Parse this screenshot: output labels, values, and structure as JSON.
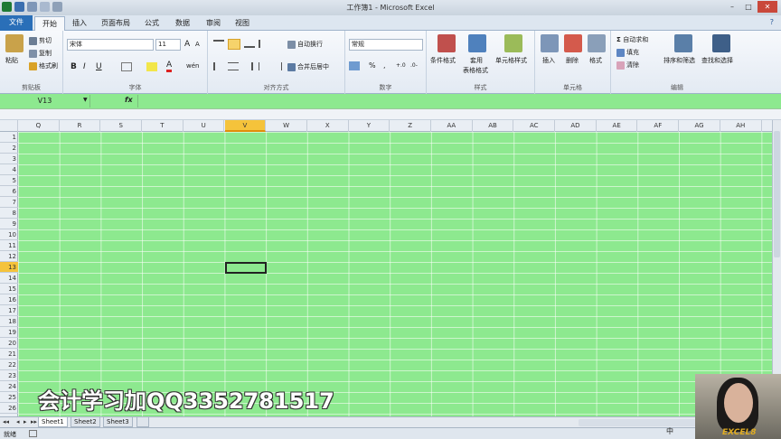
{
  "window": {
    "title": "工作簿1 - Microsoft Excel",
    "controls": [
      "–",
      "□",
      "✕"
    ]
  },
  "tabs": [
    {
      "label": "文件"
    },
    {
      "label": "开始"
    },
    {
      "label": "插入"
    },
    {
      "label": "页面布局"
    },
    {
      "label": "公式"
    },
    {
      "label": "数据"
    },
    {
      "label": "审阅"
    },
    {
      "label": "视图"
    }
  ],
  "ribbon": {
    "clipboard": {
      "group": "剪贴板",
      "paste": "粘贴",
      "cut": "剪切",
      "copy": "复制",
      "format_painter": "格式刷"
    },
    "font": {
      "group": "字体",
      "name": "宋体",
      "size": "11",
      "bold": "B",
      "italic": "I",
      "underline": "U",
      "font_color": "A",
      "grow": "A",
      "shrink": "A",
      "pinyin": "wén"
    },
    "alignment": {
      "group": "对齐方式",
      "wrap": "自动换行",
      "merge": "合并后居中"
    },
    "number": {
      "group": "数字",
      "format": "常规",
      "percent": "%",
      "comma": ",",
      "inc": "+.0",
      "dec": ".0-"
    },
    "styles": {
      "group": "样式",
      "conditional": "条件格式",
      "table_l1": "套用",
      "table_l2": "表格格式",
      "cell_styles": "单元格样式"
    },
    "cells": {
      "group": "单元格",
      "insert": "插入",
      "delete": "删除",
      "format": "格式"
    },
    "editing": {
      "group": "编辑",
      "autosum": "自动求和",
      "fill": "填充",
      "clear": "清除",
      "sort": "排序和筛选",
      "find": "查找和选择"
    }
  },
  "formula": {
    "name_box": "V13",
    "fx": "fx",
    "value": ""
  },
  "columns": [
    "Q",
    "R",
    "S",
    "T",
    "U",
    "V",
    "W",
    "X",
    "Y",
    "Z",
    "AA",
    "AB",
    "AC",
    "AD",
    "AE",
    "AF",
    "AG",
    "AH"
  ],
  "rows": [
    "1",
    "2",
    "3",
    "4",
    "5",
    "6",
    "7",
    "8",
    "9",
    "10",
    "11",
    "12",
    "13",
    "14",
    "15",
    "16",
    "17",
    "18",
    "19",
    "20",
    "21",
    "22",
    "23",
    "24",
    "25",
    "26"
  ],
  "selected": {
    "column": "V",
    "row": "13"
  },
  "sheets": [
    "Sheet1",
    "Sheet2",
    "Sheet3"
  ],
  "status": {
    "text": "就绪",
    "ime": "中"
  },
  "overlay": {
    "watermark": "会计学习加QQ3352781517",
    "logo": "EXCEL8"
  },
  "colors": {
    "sheet_bg": "#8de98f",
    "selected_header": "#f5c33b",
    "file_tab": "#2a6fb8"
  }
}
